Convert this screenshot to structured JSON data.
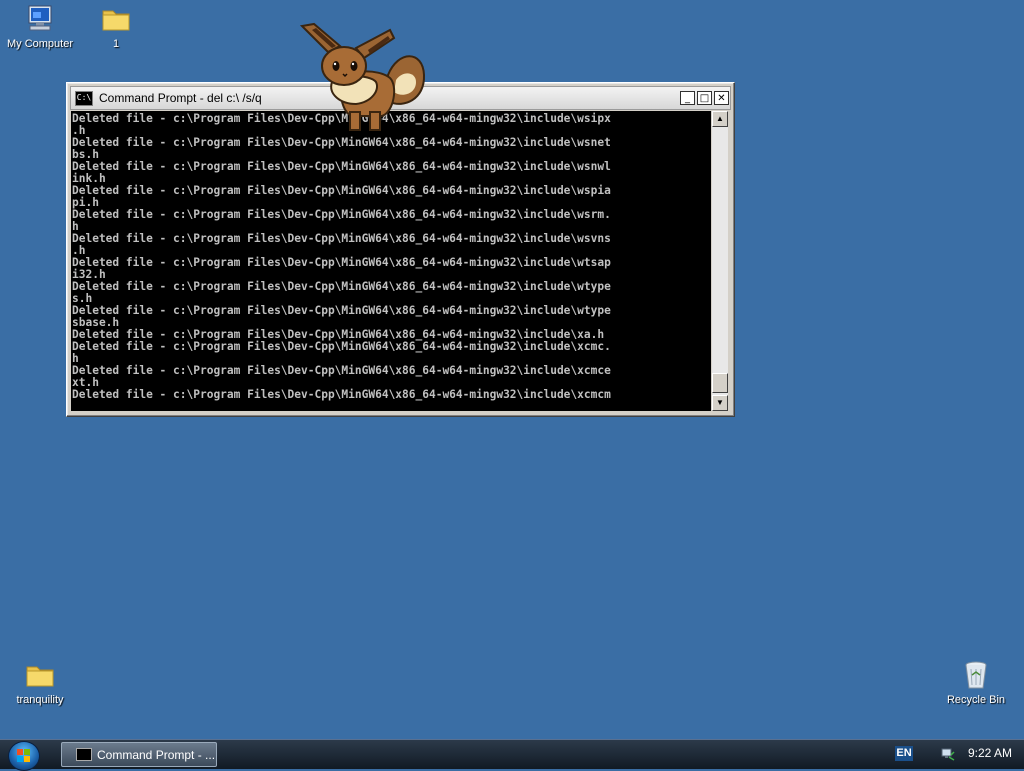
{
  "desktop": {
    "icons": {
      "my_computer": "My Computer",
      "folder_1": "1",
      "tranquility": "tranquility",
      "recycle_bin": "Recycle Bin"
    }
  },
  "cmd_window": {
    "title": "Command Prompt - del c:\\ /s/q",
    "icon_text": "C:\\",
    "minimize": "_",
    "maximize": "□",
    "close": "✕",
    "console_text": "Deleted file - c:\\Program Files\\Dev-Cpp\\MinGW64\\x86_64-w64-mingw32\\include\\wsipx\n.h\nDeleted file - c:\\Program Files\\Dev-Cpp\\MinGW64\\x86_64-w64-mingw32\\include\\wsnet\nbs.h\nDeleted file - c:\\Program Files\\Dev-Cpp\\MinGW64\\x86_64-w64-mingw32\\include\\wsnwl\nink.h\nDeleted file - c:\\Program Files\\Dev-Cpp\\MinGW64\\x86_64-w64-mingw32\\include\\wspia\npi.h\nDeleted file - c:\\Program Files\\Dev-Cpp\\MinGW64\\x86_64-w64-mingw32\\include\\wsrm.\nh\nDeleted file - c:\\Program Files\\Dev-Cpp\\MinGW64\\x86_64-w64-mingw32\\include\\wsvns\n.h\nDeleted file - c:\\Program Files\\Dev-Cpp\\MinGW64\\x86_64-w64-mingw32\\include\\wtsap\ni32.h\nDeleted file - c:\\Program Files\\Dev-Cpp\\MinGW64\\x86_64-w64-mingw32\\include\\wtype\ns.h\nDeleted file - c:\\Program Files\\Dev-Cpp\\MinGW64\\x86_64-w64-mingw32\\include\\wtype\nsbase.h\nDeleted file - c:\\Program Files\\Dev-Cpp\\MinGW64\\x86_64-w64-mingw32\\include\\xa.h\nDeleted file - c:\\Program Files\\Dev-Cpp\\MinGW64\\x86_64-w64-mingw32\\include\\xcmc.\nh\nDeleted file - c:\\Program Files\\Dev-Cpp\\MinGW64\\x86_64-w64-mingw32\\include\\xcmce\nxt.h\nDeleted file - c:\\Program Files\\Dev-Cpp\\MinGW64\\x86_64-w64-mingw32\\include\\xcmcm",
    "scroll_up": "▲",
    "scroll_down": "▼"
  },
  "taskbar": {
    "task_label": "Command Prompt - ...",
    "language": "EN",
    "clock": "9:22 AM"
  },
  "colors": {
    "desktop_background": "#3a6ea5",
    "console_background": "#000000",
    "console_text": "#c0c0c0"
  }
}
